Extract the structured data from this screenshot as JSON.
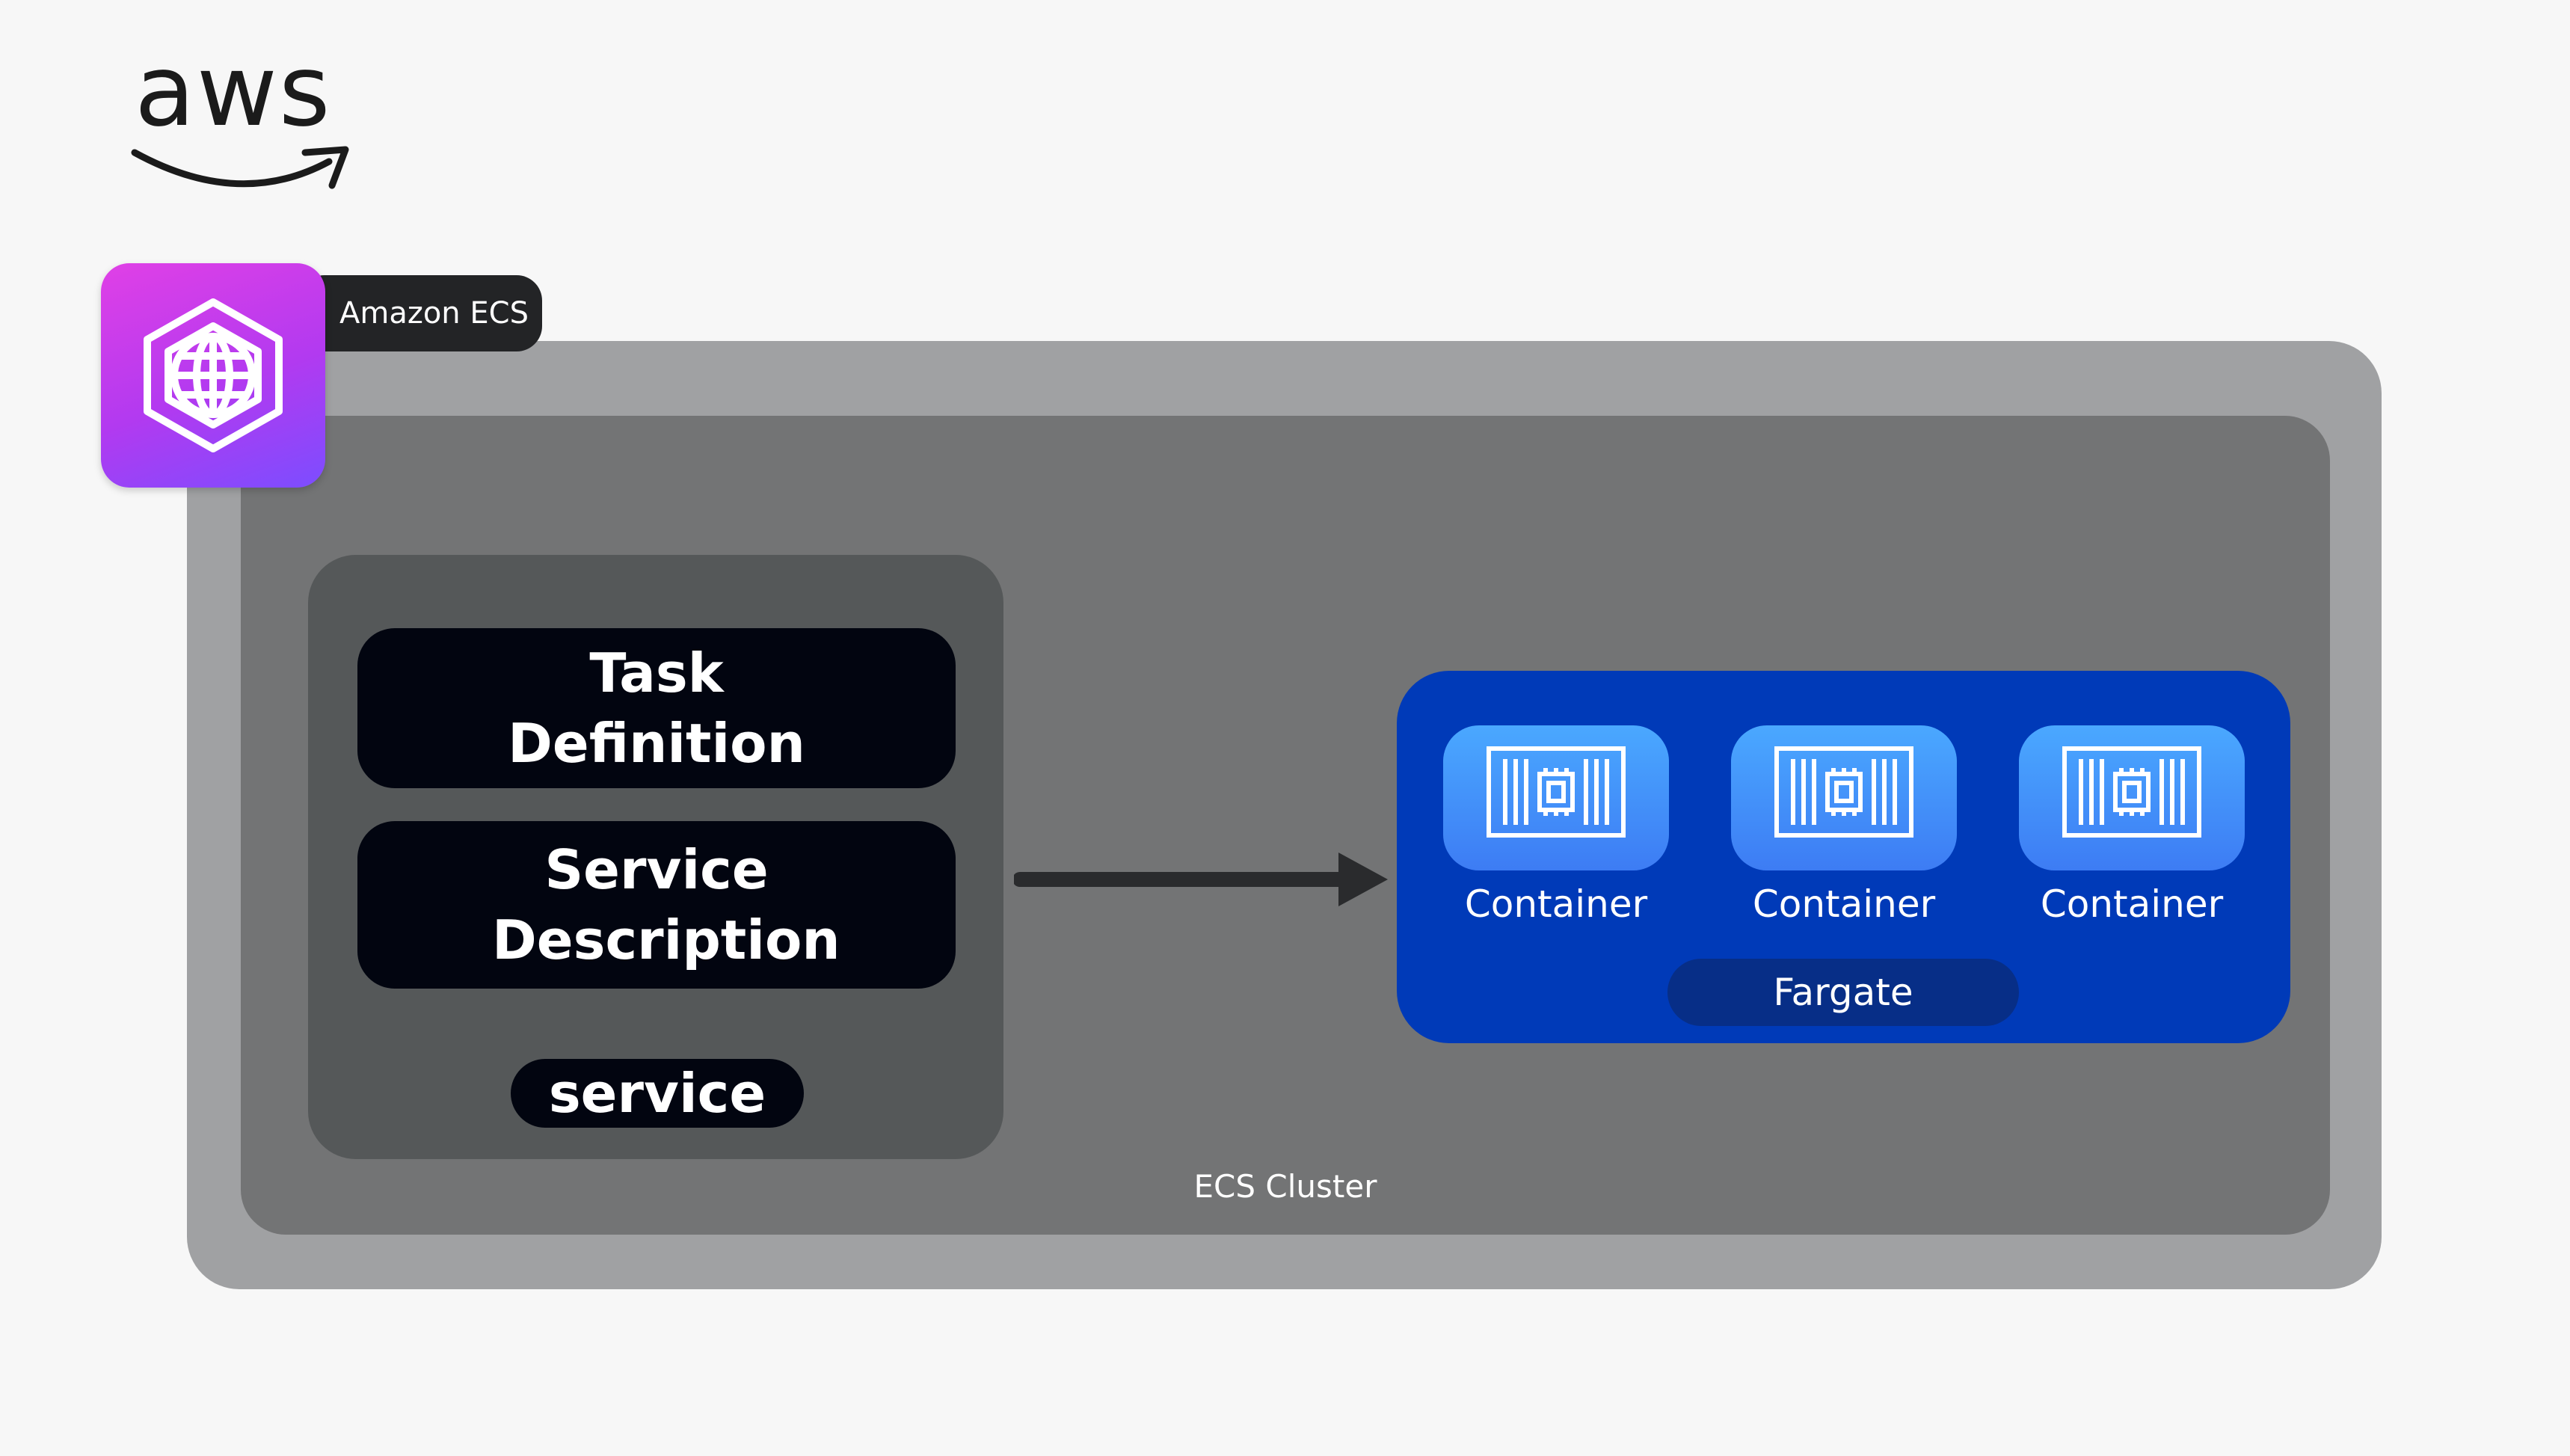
{
  "logo": {
    "text": "aws",
    "name": "aws-logo"
  },
  "service": {
    "label": "Amazon ECS",
    "icon": "ecs-icon"
  },
  "cluster": {
    "label": "ECS Cluster"
  },
  "definitions": {
    "task_definition": "Task Definition",
    "service_description": "Service Description",
    "service_pill": "service"
  },
  "fargate": {
    "label": "Fargate",
    "containers": [
      {
        "label": "Container",
        "icon": "container-icon"
      },
      {
        "label": "Container",
        "icon": "container-icon"
      },
      {
        "label": "Container",
        "icon": "container-icon"
      }
    ]
  },
  "colors": {
    "background": "#f7f7f7",
    "outer_box": "#a0a1a3",
    "cluster_box": "#737475",
    "service_group": "#555859",
    "definition_box": "#020510",
    "fargate_box": "#003ab8",
    "fargate_pill": "#072e87",
    "container_tile": "#3d7cf4",
    "ecs_icon_gradient_start": "#e040e6",
    "ecs_icon_gradient_end": "#7c4dff"
  }
}
